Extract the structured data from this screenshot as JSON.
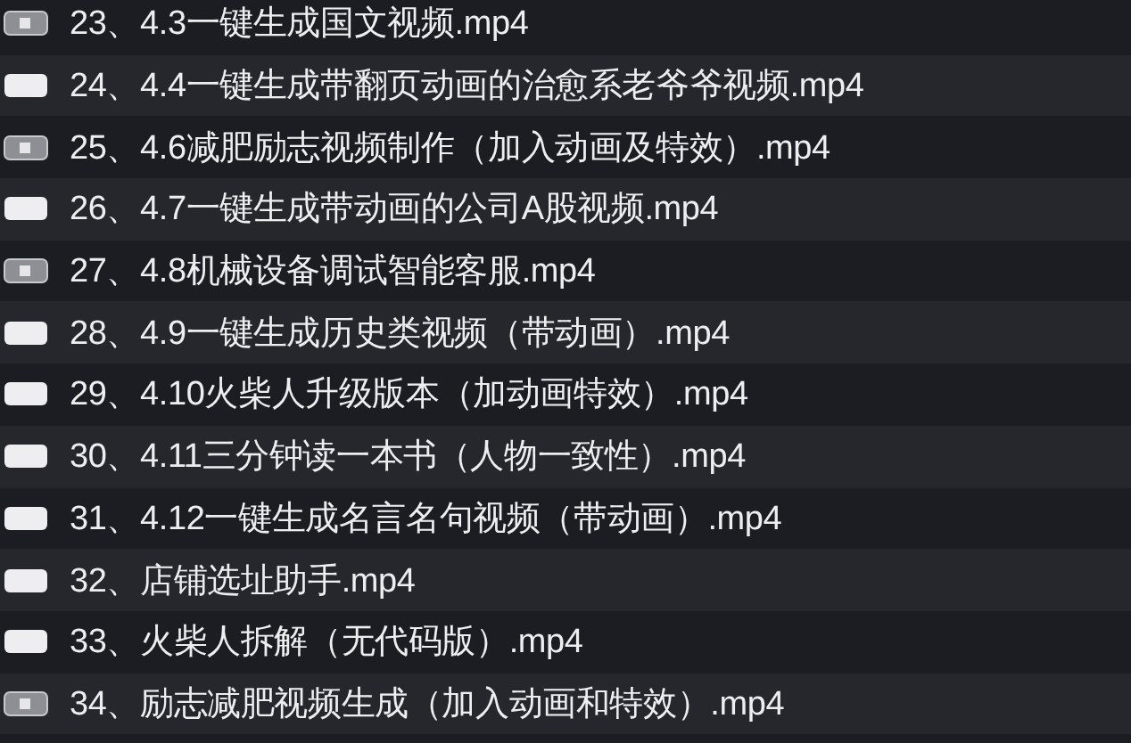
{
  "files": [
    {
      "name": "23、4.3一键生成国文视频.mp4",
      "kind": "thumbnail"
    },
    {
      "name": "24、4.4一键生成带翻页动画的治愈系老爷爷视频.mp4",
      "kind": "blank"
    },
    {
      "name": "25、4.6减肥励志视频制作（加入动画及特效）.mp4",
      "kind": "thumbnail"
    },
    {
      "name": "26、4.7一键生成带动画的公司A股视频.mp4",
      "kind": "blank"
    },
    {
      "name": "27、4.8机械设备调试智能客服.mp4",
      "kind": "thumbnail"
    },
    {
      "name": "28、4.9一键生成历史类视频（带动画）.mp4",
      "kind": "blank"
    },
    {
      "name": "29、4.10火柴人升级版本（加动画特效）.mp4",
      "kind": "blank"
    },
    {
      "name": "30、4.11三分钟读一本书（人物一致性）.mp4",
      "kind": "blank"
    },
    {
      "name": "31、4.12一键生成名言名句视频（带动画）.mp4",
      "kind": "blank"
    },
    {
      "name": "32、店铺选址助手.mp4",
      "kind": "blank"
    },
    {
      "name": "33、火柴人拆解（无代码版）.mp4",
      "kind": "blank"
    },
    {
      "name": "34、励志减肥视频生成（加入动画和特效）.mp4",
      "kind": "thumbnail"
    }
  ]
}
